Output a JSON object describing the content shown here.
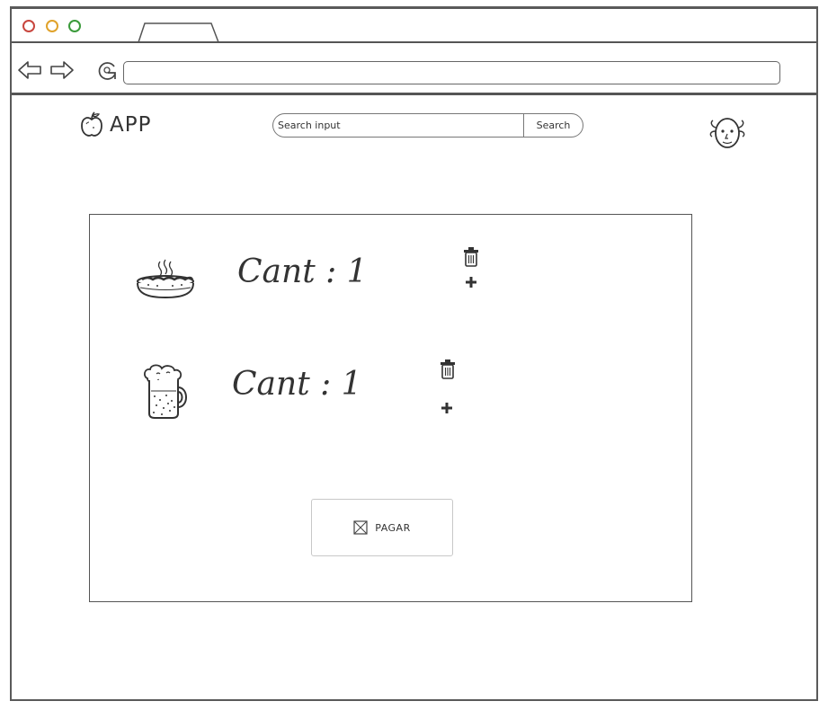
{
  "browser": {
    "address_value": "",
    "window_controls": [
      "close",
      "minimize",
      "maximize"
    ]
  },
  "header": {
    "logo_label": "APP",
    "logo_icon": "apple-icon",
    "search": {
      "placeholder": "Search input",
      "button_label": "Search"
    },
    "avatar_icon": "user-face-icon"
  },
  "cart": {
    "items": [
      {
        "icon": "hotdog-icon",
        "quantity_label": "Cant : 1",
        "actions": [
          "trash-icon",
          "plus-icon"
        ]
      },
      {
        "icon": "beer-mug-icon",
        "quantity_label": "Cant : 1",
        "actions": [
          "trash-icon",
          "plus-icon"
        ]
      }
    ],
    "pay_button": {
      "label": "PAGAR",
      "icon": "image-placeholder-icon"
    }
  },
  "colors": {
    "close_dot": "#c8463e",
    "minimize_dot": "#e0a22b",
    "maximize_dot": "#3a9a3a",
    "stroke": "#555555"
  }
}
